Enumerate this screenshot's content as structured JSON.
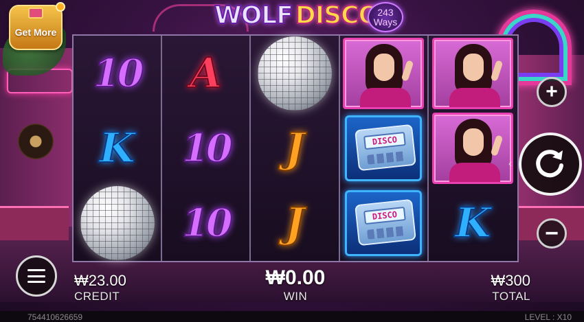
{
  "game": {
    "title_word1": "WOLF",
    "title_word2": "DISCO",
    "ways_count": "243",
    "ways_label": "Ways"
  },
  "promo": {
    "get_more_label": "Get More"
  },
  "reels": [
    [
      "10",
      "K",
      "disco-ball"
    ],
    [
      "A",
      "10",
      "10"
    ],
    [
      "disco-ball",
      "J",
      "J"
    ],
    [
      "lady-portrait",
      "pager",
      "pager"
    ],
    [
      "lady-portrait",
      "lady-portrait",
      "K"
    ]
  ],
  "pager_screen_text": "DISCO",
  "bottom_bar": {
    "credit_value": "₩23.00",
    "credit_label": "CREDIT",
    "win_value": "₩0.00",
    "win_label": "WIN",
    "total_value": "₩300",
    "total_label": "TOTAL"
  },
  "footer": {
    "session_id": "754410626659",
    "level_text": "LEVEL : X10"
  },
  "colors": {
    "accent_pink": "#e83fb1",
    "k_blue": "#2fb0ff",
    "j_orange": "#ffa223",
    "ten_purple": "#d56dff",
    "a_red": "#ff3f5e"
  }
}
